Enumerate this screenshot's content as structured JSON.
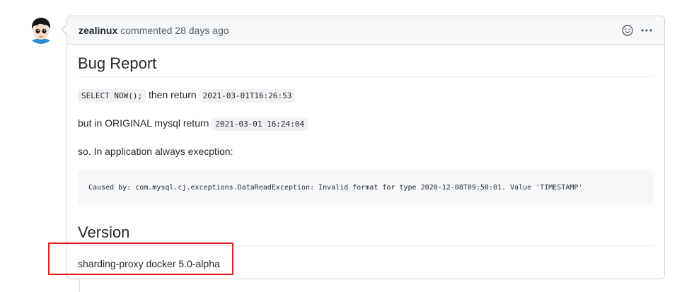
{
  "comment": {
    "author": "zealinux",
    "action": "commented",
    "timestamp": "28 days ago",
    "header_icons": [
      "smiley-icon",
      "kebab-menu-icon"
    ]
  },
  "body": {
    "bug_heading": "Bug Report",
    "line1": {
      "code1": "SELECT NOW();",
      "text": "then return",
      "code2": "2021-03-01T16:26:53"
    },
    "line2": {
      "text": "but in ORIGINAL mysql return",
      "code": "2021-03-01 16:24:04"
    },
    "line3": "so. In application always execption:",
    "code_block": "Caused by: com.mysql.cj.exceptions.DataReadException: Invalid format for type 2020-12-08T09:50:01. Value 'TIMESTAMP'",
    "version_heading": "Version",
    "version_text": "sharding-proxy docker 5.0-alpha"
  },
  "colors": {
    "highlight": "#e0201e",
    "border": "#d1d5da",
    "header_bg": "#f6f8fa"
  }
}
